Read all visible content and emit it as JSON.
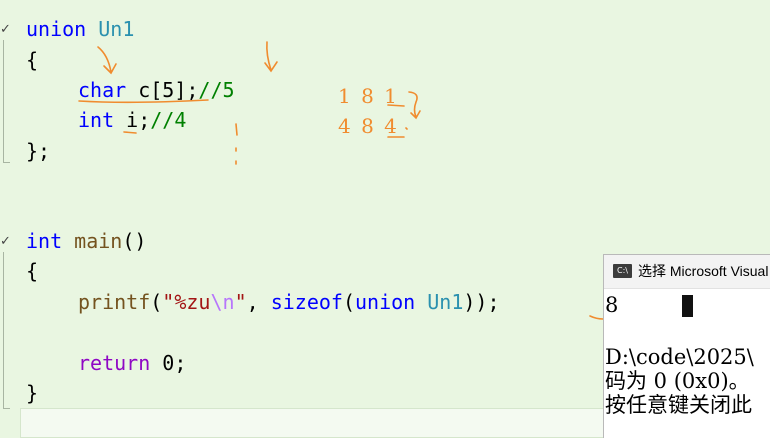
{
  "editor": {
    "code": {
      "union_kw": "union",
      "union_name": "Un1",
      "brace_open": "{",
      "char_type": "char",
      "char_decl": " c[5];",
      "char_comment": "//5",
      "int_type": "int",
      "int_decl": " i;",
      "int_comment": "//4",
      "brace_close_semi": "};",
      "main_type": "int",
      "main_name": "main",
      "main_parens": "()",
      "printf_fn": "printf",
      "printf_open": "(",
      "printf_str_a": "\"%zu",
      "printf_str_esc": "\\n",
      "printf_str_b": "\"",
      "printf_comma": ", ",
      "sizeof_kw": "sizeof",
      "sizeof_open": "(",
      "sizeof_union": "union",
      "sizeof_name": "Un1",
      "printf_close": "));",
      "return_kw": "return",
      "return_value": " 0;",
      "brace_close": "}"
    },
    "fold_glyph": "✓",
    "annotations": {
      "row1": "1 8 1",
      "row2": "4 8 4",
      "color": "#f08c2f"
    }
  },
  "console": {
    "icon_label": "C:\\",
    "title": "选择 Microsoft Visual Studio 调试控制台",
    "lines": [
      "8",
      "D:\\code\\2025\\",
      "码为 0 (0x0)。",
      "按任意键关闭此"
    ]
  },
  "colors": {
    "editor_bg": "#e9f6e1",
    "keyword": "#0000ff",
    "type_name": "#2b91af",
    "function": "#74531f",
    "string": "#a31515",
    "comment": "#008000",
    "annotation": "#f08c2f"
  }
}
